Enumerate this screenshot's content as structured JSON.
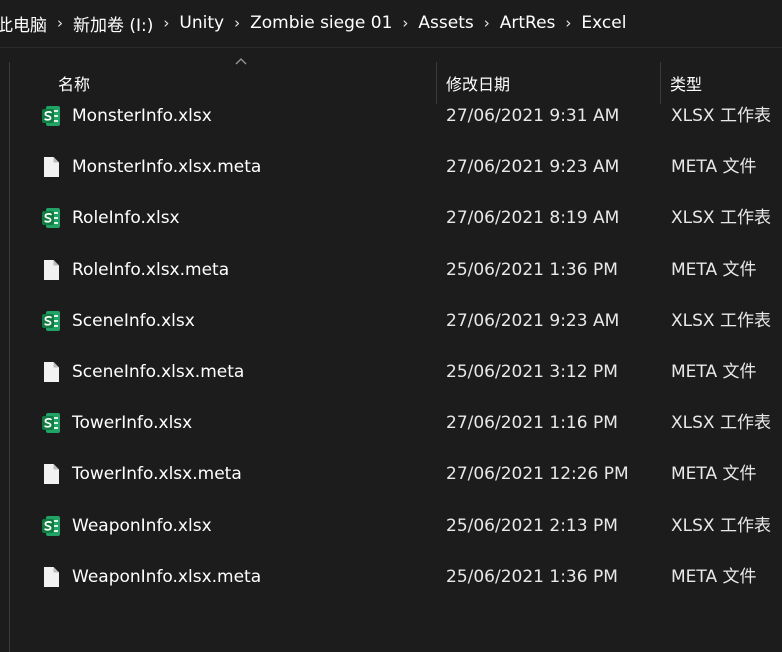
{
  "breadcrumb": [
    {
      "label": "此电脑"
    },
    {
      "label": "新加卷 (I:)"
    },
    {
      "label": "Unity"
    },
    {
      "label": "Zombie siege 01"
    },
    {
      "label": "Assets"
    },
    {
      "label": "ArtRes"
    },
    {
      "label": "Excel"
    }
  ],
  "breadcrumb_separator": "›",
  "columns": {
    "name": "名称",
    "date": "修改日期",
    "type": "类型"
  },
  "sort": {
    "column": "name",
    "direction": "ascending"
  },
  "colors": {
    "background": "#1c1c1c",
    "text": "#ffffff",
    "excel_icon": "#21a366",
    "file_icon": "#f2f2f2",
    "divider": "#3a3a3a"
  },
  "files": [
    {
      "name": "MonsterInfo.xlsx",
      "date": "27/06/2021 9:31 AM",
      "type": "XLSX 工作表",
      "icon": "excel-icon"
    },
    {
      "name": "MonsterInfo.xlsx.meta",
      "date": "27/06/2021 9:23 AM",
      "type": "META 文件",
      "icon": "file-icon"
    },
    {
      "name": "RoleInfo.xlsx",
      "date": "27/06/2021 8:19 AM",
      "type": "XLSX 工作表",
      "icon": "excel-icon"
    },
    {
      "name": "RoleInfo.xlsx.meta",
      "date": "25/06/2021 1:36 PM",
      "type": "META 文件",
      "icon": "file-icon"
    },
    {
      "name": "SceneInfo.xlsx",
      "date": "27/06/2021 9:23 AM",
      "type": "XLSX 工作表",
      "icon": "excel-icon"
    },
    {
      "name": "SceneInfo.xlsx.meta",
      "date": "25/06/2021 3:12 PM",
      "type": "META 文件",
      "icon": "file-icon"
    },
    {
      "name": "TowerInfo.xlsx",
      "date": "27/06/2021 1:16 PM",
      "type": "XLSX 工作表",
      "icon": "excel-icon"
    },
    {
      "name": "TowerInfo.xlsx.meta",
      "date": "27/06/2021 12:26 PM",
      "type": "META 文件",
      "icon": "file-icon"
    },
    {
      "name": "WeaponInfo.xlsx",
      "date": "25/06/2021 2:13 PM",
      "type": "XLSX 工作表",
      "icon": "excel-icon"
    },
    {
      "name": "WeaponInfo.xlsx.meta",
      "date": "25/06/2021 1:36 PM",
      "type": "META 文件",
      "icon": "file-icon"
    }
  ]
}
